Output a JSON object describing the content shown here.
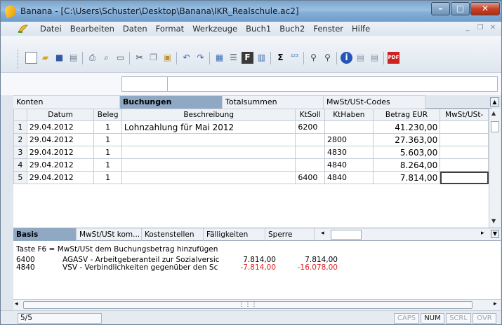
{
  "window": {
    "title": "Banana - [C:\\Users\\Schuster\\Desktop\\Banana\\IKR_Realschule.ac2]"
  },
  "menu": [
    "Datei",
    "Bearbeiten",
    "Daten",
    "Format",
    "Werkzeuge",
    "Buch1",
    "Buch2",
    "Fenster",
    "Hilfe"
  ],
  "tables_tabs": [
    "Konten",
    "Buchungen",
    "Totalsummen",
    "MwSt/USt-Codes"
  ],
  "grid": {
    "headers": {
      "datum": "Datum",
      "beleg": "Beleg",
      "beschreibung": "Beschreibung",
      "ktsoll": "KtSoll",
      "kthaben": "KtHaben",
      "betrag": "Betrag EUR",
      "mwst": "MwSt/USt-"
    },
    "rows": [
      {
        "n": "1",
        "datum": "29.04.2012",
        "beleg": "1",
        "beschreibung": "Lohnzahlung für Mai 2012",
        "ktsoll": "6200",
        "kthaben": "",
        "betrag": "41.230,00",
        "mwst": ""
      },
      {
        "n": "2",
        "datum": "29.04.2012",
        "beleg": "1",
        "beschreibung": "",
        "ktsoll": "",
        "kthaben": "2800",
        "betrag": "27.363,00",
        "mwst": ""
      },
      {
        "n": "3",
        "datum": "29.04.2012",
        "beleg": "1",
        "beschreibung": "",
        "ktsoll": "",
        "kthaben": "4830",
        "betrag": "5.603,00",
        "mwst": ""
      },
      {
        "n": "4",
        "datum": "29.04.2012",
        "beleg": "1",
        "beschreibung": "",
        "ktsoll": "",
        "kthaben": "4840",
        "betrag": "8.264,00",
        "mwst": ""
      },
      {
        "n": "5",
        "datum": "29.04.2012",
        "beleg": "1",
        "beschreibung": "",
        "ktsoll": "6400",
        "kthaben": "4840",
        "betrag": "7.814,00",
        "mwst": ""
      }
    ]
  },
  "view_tabs": [
    "Basis",
    "MwSt/USt kom...",
    "Kostenstellen",
    "Fälligkeiten",
    "Sperre"
  ],
  "info": {
    "hint": "Taste F6 = MwSt/USt dem Buchungsbetrag hinzufügen",
    "lines": [
      {
        "account": "6400",
        "text": "AGASV - Arbeitgeberanteil zur Sozialversic",
        "amount": "7.814,00",
        "balance": "7.814,00",
        "negative": false
      },
      {
        "account": "4840",
        "text": "VSV - Verbindlichkeiten gegenüber den Sc",
        "amount": "-7.814,00",
        "balance": "-16.078,00",
        "negative": true
      }
    ]
  },
  "status": {
    "count": "5/5",
    "indicators": [
      "CAPS",
      "NUM",
      "SCRL",
      "OVR"
    ],
    "active": "NUM"
  },
  "colors": {
    "active_tab": "#8fa9c5",
    "negative": "#e02020"
  }
}
